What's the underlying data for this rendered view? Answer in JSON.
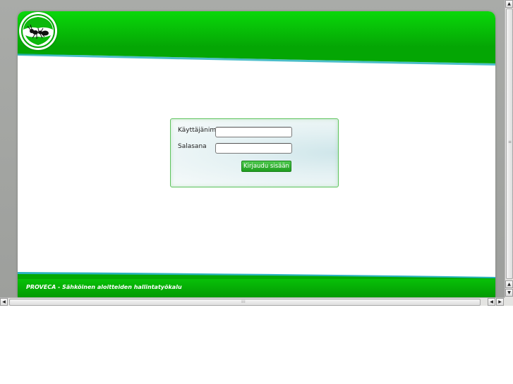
{
  "header": {
    "logo_icon": "ant-logo-icon"
  },
  "login": {
    "username_label": "Käyttäjänimi",
    "username_value": "",
    "password_label": "Salasana",
    "password_value": "",
    "submit_label": "Kirjaudu sisään"
  },
  "footer": {
    "text": "PROVECA - Sähköinen aloitteiden hallintatyökalu"
  },
  "scrollbars": {
    "vertical_up_icon": "arrow-up-icon",
    "vertical_down_icon": "arrow-down-icon",
    "horizontal_left_icon": "arrow-left-icon",
    "horizontal_right_icon": "arrow-right-icon"
  },
  "colors": {
    "brand_green": "#06b306",
    "accent_teal": "#2bb3c0"
  }
}
